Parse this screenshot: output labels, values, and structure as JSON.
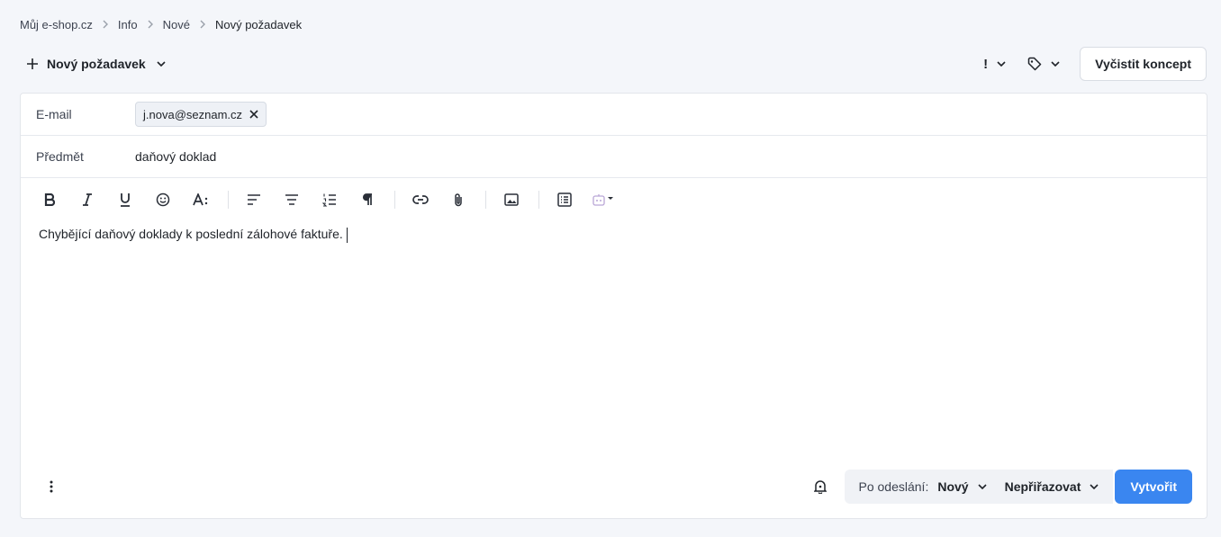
{
  "breadcrumb": {
    "items": [
      "Můj e-shop.cz",
      "Info",
      "Nové",
      "Nový požadavek"
    ]
  },
  "topbar": {
    "new_label": "Nový požadavek",
    "priority_symbol": "!",
    "clear_label": "Vyčistit koncept"
  },
  "form": {
    "email_label": "E-mail",
    "email_chip": "j.nova@seznam.cz",
    "subject_label": "Předmět",
    "subject_value": "daňový doklad"
  },
  "toolbar": {
    "icons": [
      "bold-icon",
      "italic-icon",
      "underline-icon",
      "emoji-icon",
      "text-size-icon",
      "align-left-icon",
      "align-center-icon",
      "ordered-list-icon",
      "paragraph-icon",
      "link-icon",
      "attachment-icon",
      "image-icon",
      "template-icon",
      "ai-assistant-icon"
    ]
  },
  "editor": {
    "text": "Chybějící daňový doklady k poslední zálohové faktuře."
  },
  "footer": {
    "after_send_label": "Po odeslání:",
    "status_value": "Nový",
    "assign_value": "Nepřiřazovat",
    "create_label": "Vytvořit"
  },
  "colors": {
    "primary": "#3a86f0",
    "background": "#f4f6fa",
    "chip_bg": "#eef1f6"
  }
}
